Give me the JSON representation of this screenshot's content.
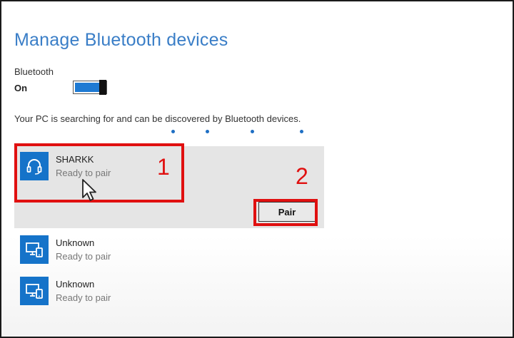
{
  "page": {
    "title": "Manage Bluetooth devices"
  },
  "bluetooth": {
    "label": "Bluetooth",
    "state": "On",
    "enabled": true
  },
  "status_text": "Your PC is searching for and can be discovered by Bluetooth devices.",
  "devices": [
    {
      "name": "SHARKK",
      "status": "Ready to pair",
      "icon": "headset-icon",
      "selected": true
    },
    {
      "name": "Unknown",
      "status": "Ready to pair",
      "icon": "pc-phone-icon",
      "selected": false
    },
    {
      "name": "Unknown",
      "status": "Ready to pair",
      "icon": "pc-phone-icon",
      "selected": false
    }
  ],
  "pair_button": {
    "label": "Pair"
  },
  "annotations": {
    "step1": "1",
    "step2": "2"
  },
  "colors": {
    "accent": "#1573c9",
    "title": "#3a7ec7",
    "annotation": "#e01010",
    "selected_bg": "#e5e5e5"
  }
}
